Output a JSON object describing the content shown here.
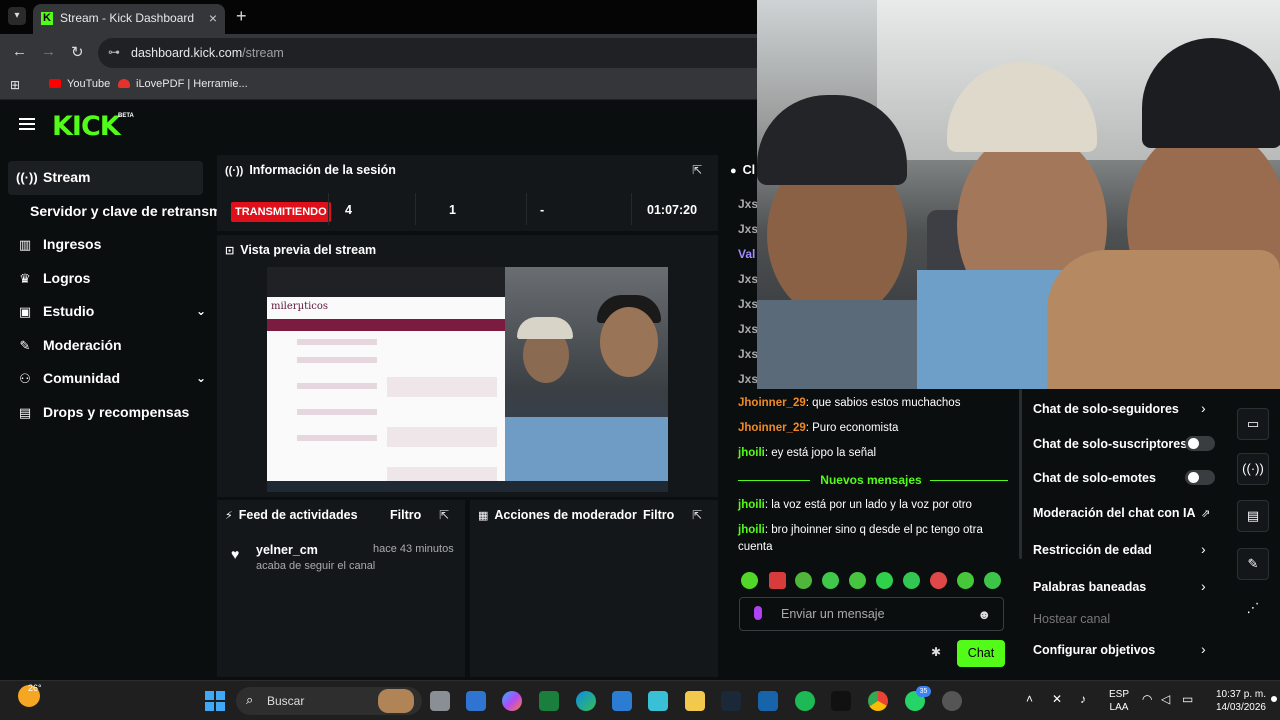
{
  "browser": {
    "tab_title": "Stream - Kick Dashboard",
    "tab_close": "×",
    "new_tab": "+",
    "url_host": "dashboard.kick.com",
    "url_path": "/stream",
    "bookmarks": [
      {
        "label": "YouTube",
        "color": "#ff0000"
      },
      {
        "label": "iLovePDF | Herramie...",
        "color": "#e5322d"
      }
    ]
  },
  "logo": {
    "text": "KICK",
    "badge": "BETA"
  },
  "sidebar": {
    "items": [
      {
        "label": "Stream"
      },
      {
        "label": "Servidor y clave de retransm"
      },
      {
        "label": "Ingresos"
      },
      {
        "label": "Logros"
      },
      {
        "label": "Estudio"
      },
      {
        "label": "Moderación"
      },
      {
        "label": "Comunidad"
      },
      {
        "label": "Drops y recompensas"
      }
    ]
  },
  "session": {
    "title": "Información de la sesión",
    "status": "TRANSMITIENDO",
    "stat1": "4",
    "stat2": "1",
    "stat3": "-",
    "duration": "01:07:20"
  },
  "preview": {
    "title": "Vista previa del stream",
    "site_logo": "milerµticos"
  },
  "feed": {
    "title": "Feed de actividades",
    "filter": "Filtro",
    "user": "yelner_cm",
    "time": "hace 43 minutos",
    "desc": "acaba de seguir el canal"
  },
  "mod_actions": {
    "title": "Acciones de moderador",
    "filter": "Filtro"
  },
  "chat": {
    "header_trunc": "Cl",
    "trunc_users": [
      "Jxs",
      "Jxs",
      "Val",
      "Jxs",
      "Jxs",
      "Jxs",
      "Jxs",
      "Jxs"
    ],
    "messages": [
      {
        "user": "Jhoinner_29",
        "text": ": que sabios estos muchachos"
      },
      {
        "user": "Jhoinner_29",
        "text": ": Puro economista"
      },
      {
        "user": "jhoili",
        "text": ": ey está jopo la señal"
      }
    ],
    "new_messages": "Nuevos mensajes",
    "new_msgs": [
      {
        "user": "jhoili",
        "text": ": la voz está por un lado y la voz por otro"
      },
      {
        "user": "jhoili",
        "text": ": bro jhoinner sino q desde el pc tengo otra",
        "text2": "cuenta"
      }
    ],
    "placeholder": "Enviar un mensaje",
    "send": "Chat"
  },
  "mod_panel": {
    "items": [
      {
        "label": "Chat de solo-seguidores",
        "control": "chevron"
      },
      {
        "label": "Chat de solo-suscriptores",
        "control": "toggle"
      },
      {
        "label": "Chat de solo-emotes",
        "control": "toggle"
      },
      {
        "label": "Moderación del chat con IA",
        "control": "external"
      },
      {
        "label": "Restricción de edad",
        "control": "chevron"
      },
      {
        "label": "Palabras baneadas",
        "control": "chevron"
      },
      {
        "label": "Hostear canal",
        "control": "none"
      },
      {
        "label": "Configurar objetivos",
        "control": "chevron"
      }
    ]
  },
  "taskbar": {
    "temp": "26°",
    "search": "Buscar",
    "badge": "35",
    "lang1": "ESP",
    "lang2": "LAA",
    "time": "10:37 p. m.",
    "date": "14/03/2026"
  },
  "colors": {
    "brand": "#53fc18",
    "live": "#e0101b",
    "username_orange": "#f08a24",
    "username_green": "#53fc18"
  }
}
